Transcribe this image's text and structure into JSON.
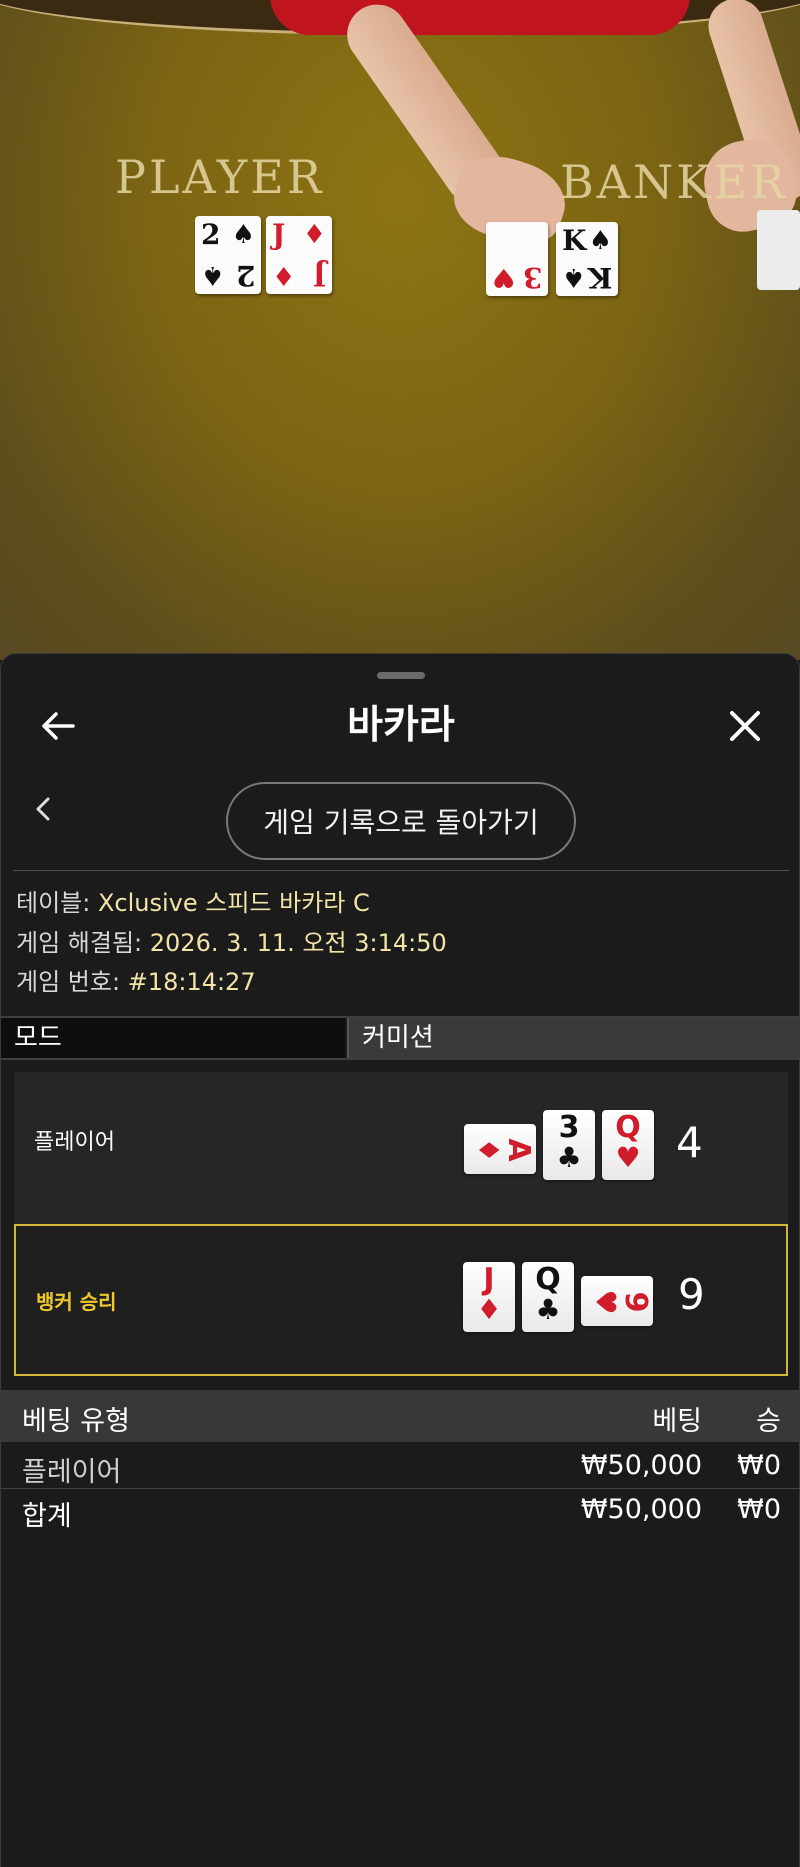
{
  "video": {
    "felt_player_label": "PLAYER",
    "felt_banker_label": "BANKER",
    "player_cards": [
      {
        "rank": "2",
        "suit": "♠",
        "color": "black"
      },
      {
        "rank": "J",
        "suit": "♦",
        "color": "red"
      }
    ],
    "banker_cards": [
      {
        "rank": "3",
        "suit": "♥",
        "color": "red"
      },
      {
        "rank": "K",
        "suit": "♠",
        "color": "black"
      }
    ]
  },
  "header": {
    "title": "바카라",
    "back_icon": "arrow-left-icon",
    "close_icon": "close-icon"
  },
  "nav": {
    "back_history_label": "게임 기록으로 돌아가기"
  },
  "info": {
    "table_label": "테이블:",
    "table_value": "Xclusive 스피드 바카라 C",
    "resolved_label": "게임 해결됨:",
    "resolved_value": "2026. 3. 11. 오전 3:14:50",
    "game_no_label": "게임 번호:",
    "game_no_value": "#18:14:27"
  },
  "mode": {
    "label": "모드",
    "value": "커미션"
  },
  "hands": {
    "player": {
      "label": "플레이어",
      "total": "4",
      "cards": [
        {
          "rank": "A",
          "suit": "♦",
          "color": "red",
          "sideways": true
        },
        {
          "rank": "3",
          "suit": "♣",
          "color": "black",
          "sideways": false
        },
        {
          "rank": "Q",
          "suit": "♥",
          "color": "red",
          "sideways": false
        }
      ]
    },
    "banker": {
      "label": "뱅커 승리",
      "total": "9",
      "cards": [
        {
          "rank": "J",
          "suit": "♦",
          "color": "red",
          "sideways": false
        },
        {
          "rank": "Q",
          "suit": "♣",
          "color": "black",
          "sideways": false
        },
        {
          "rank": "9",
          "suit": "♥",
          "color": "red",
          "sideways": true
        }
      ]
    }
  },
  "bets": {
    "headers": {
      "type": "베팅 유형",
      "bet": "베팅",
      "win": "승"
    },
    "rows": [
      {
        "type": "플레이어",
        "bet": "₩50,000",
        "win": "₩0"
      }
    ],
    "total": {
      "type": "합계",
      "bet": "₩50,000",
      "win": "₩0"
    }
  },
  "colors": {
    "winner_accent": "#d4b536",
    "info_value": "#f2e3a7",
    "card_red": "#d11d2b"
  }
}
